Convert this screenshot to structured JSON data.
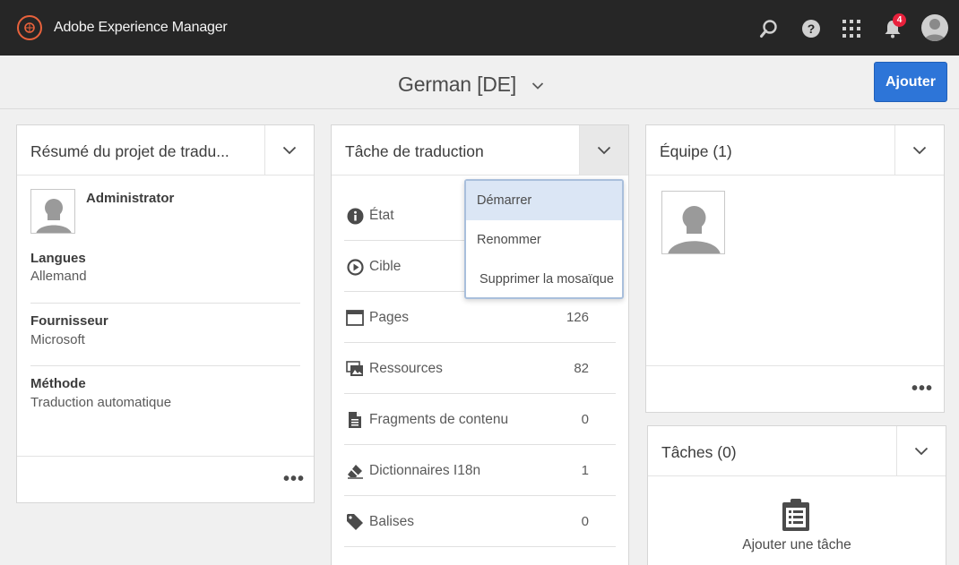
{
  "shell": {
    "app_title": "Adobe Experience Manager",
    "notifications_count": "4",
    "icons": [
      "search-icon",
      "help-icon",
      "apps-icon",
      "bell-icon",
      "user-avatar-icon"
    ],
    "brand_color": "#e9623c",
    "badge_color": "#e8213c"
  },
  "header": {
    "language_title": "German [DE]",
    "add_button": "Ajouter",
    "accent_color": "#2d75d8"
  },
  "summary_card": {
    "title": "Résumé du projet de tradu...",
    "user_name": "Administrator",
    "fields": [
      {
        "label": "Langues",
        "value": "Allemand"
      },
      {
        "label": "Fournisseur",
        "value": "Microsoft"
      },
      {
        "label": "Méthode",
        "value": "Traduction automatique"
      }
    ],
    "more": "•••"
  },
  "job_card": {
    "title": "Tâche de traduction",
    "rows": [
      {
        "icon": "info-icon",
        "label": "État",
        "count": ""
      },
      {
        "icon": "play-icon",
        "label": "Cible",
        "count": ""
      },
      {
        "icon": "pages-icon",
        "label": "Pages",
        "count": "126"
      },
      {
        "icon": "assets-icon",
        "label": "Ressources",
        "count": "82"
      },
      {
        "icon": "document-icon",
        "label": "Fragments de contenu",
        "count": "0"
      },
      {
        "icon": "eraser-icon",
        "label": "Dictionnaires I18n",
        "count": "1"
      },
      {
        "icon": "tag-icon",
        "label": "Balises",
        "count": "0"
      }
    ],
    "menu": [
      "Démarrer",
      "Renommer",
      "Supprimer la mosaïque"
    ]
  },
  "team_card": {
    "title": "Équipe (1)",
    "more": "•••"
  },
  "tasks_card": {
    "title": "Tâches (0)",
    "add_task": "Ajouter une tâche"
  }
}
